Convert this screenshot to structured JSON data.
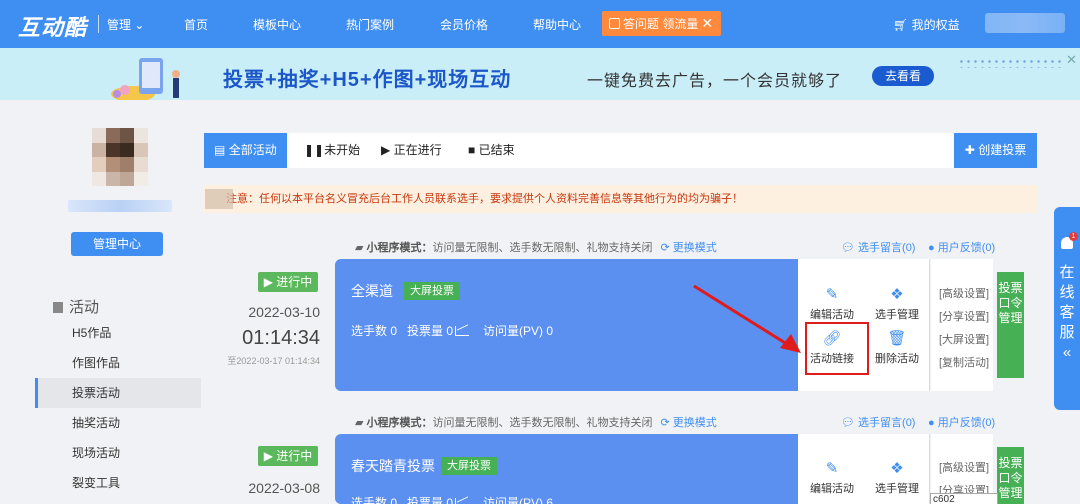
{
  "topnav": {
    "logo": "互动酷",
    "mgmt": "管理",
    "items": [
      "首页",
      "模板中心",
      "热门案例",
      "会员价格",
      "帮助中心"
    ],
    "promo": "答问题 领流量",
    "rights": "我的权益"
  },
  "banner": {
    "title": "投票+抽奖+H5+作图+现场互动",
    "subtitle": "一键免费去广告，一个会员就够了",
    "button": "去看看"
  },
  "sidebar": {
    "manage_button": "管理中心",
    "section": "活动",
    "items": [
      "H5作品",
      "作图作品",
      "投票活动",
      "抽奖活动",
      "现场活动",
      "裂变工具"
    ],
    "active_index": 2
  },
  "tabs": {
    "all": "全部活动",
    "not_started": "未开始",
    "ongoing": "正在进行",
    "ended": "已结束",
    "create": "创建投票"
  },
  "notice": "注意：任何以本平台名义冒充后台工作人员联系选手，要求提供个人资料完善信息等其他行为的均为骗子！",
  "activities": [
    {
      "mode_label": "小程序模式：",
      "mode_desc": "访问量无限制、选手数无限制、礼物支持关闭",
      "switch": "更换模式",
      "messages": "选手留言(0)",
      "feedback": "用户反馈(0)",
      "status": "进行中",
      "date": "2022-03-10",
      "time": "01:14:34",
      "range": "至2022-03-17 01:14:34",
      "title": "全渠道",
      "tag": "大屏投票",
      "stats": {
        "players": "选手数 0",
        "votes": "投票量 0",
        "visits": "访问量(PV) 0"
      },
      "actions": [
        "编辑活动",
        "选手管理",
        "活动链接",
        "删除活动"
      ],
      "settings": [
        "[高级设置]",
        "[分享设置]",
        "[大屏设置]",
        "[复制活动]"
      ],
      "cmd": "投票口令管理"
    },
    {
      "mode_label": "小程序模式：",
      "mode_desc": "访问量无限制、选手数无限制、礼物支持关闭",
      "switch": "更换模式",
      "messages": "选手留言(0)",
      "feedback": "用户反馈(0)",
      "status": "进行中",
      "date": "2022-03-08",
      "title": "春天踏青投票",
      "tag": "大屏投票",
      "stats": {
        "players": "选手数 0",
        "votes": "投票量 0",
        "visits": "访问量(PV) 6"
      },
      "actions": [
        "编辑活动",
        "选手管理"
      ],
      "settings": [
        "[高级设置]",
        "[分享设置]"
      ],
      "cmd": "投票口令管理",
      "input_value": "c602"
    }
  ],
  "service": {
    "label": "在线客服",
    "badge": "1",
    "collapse": "«"
  }
}
